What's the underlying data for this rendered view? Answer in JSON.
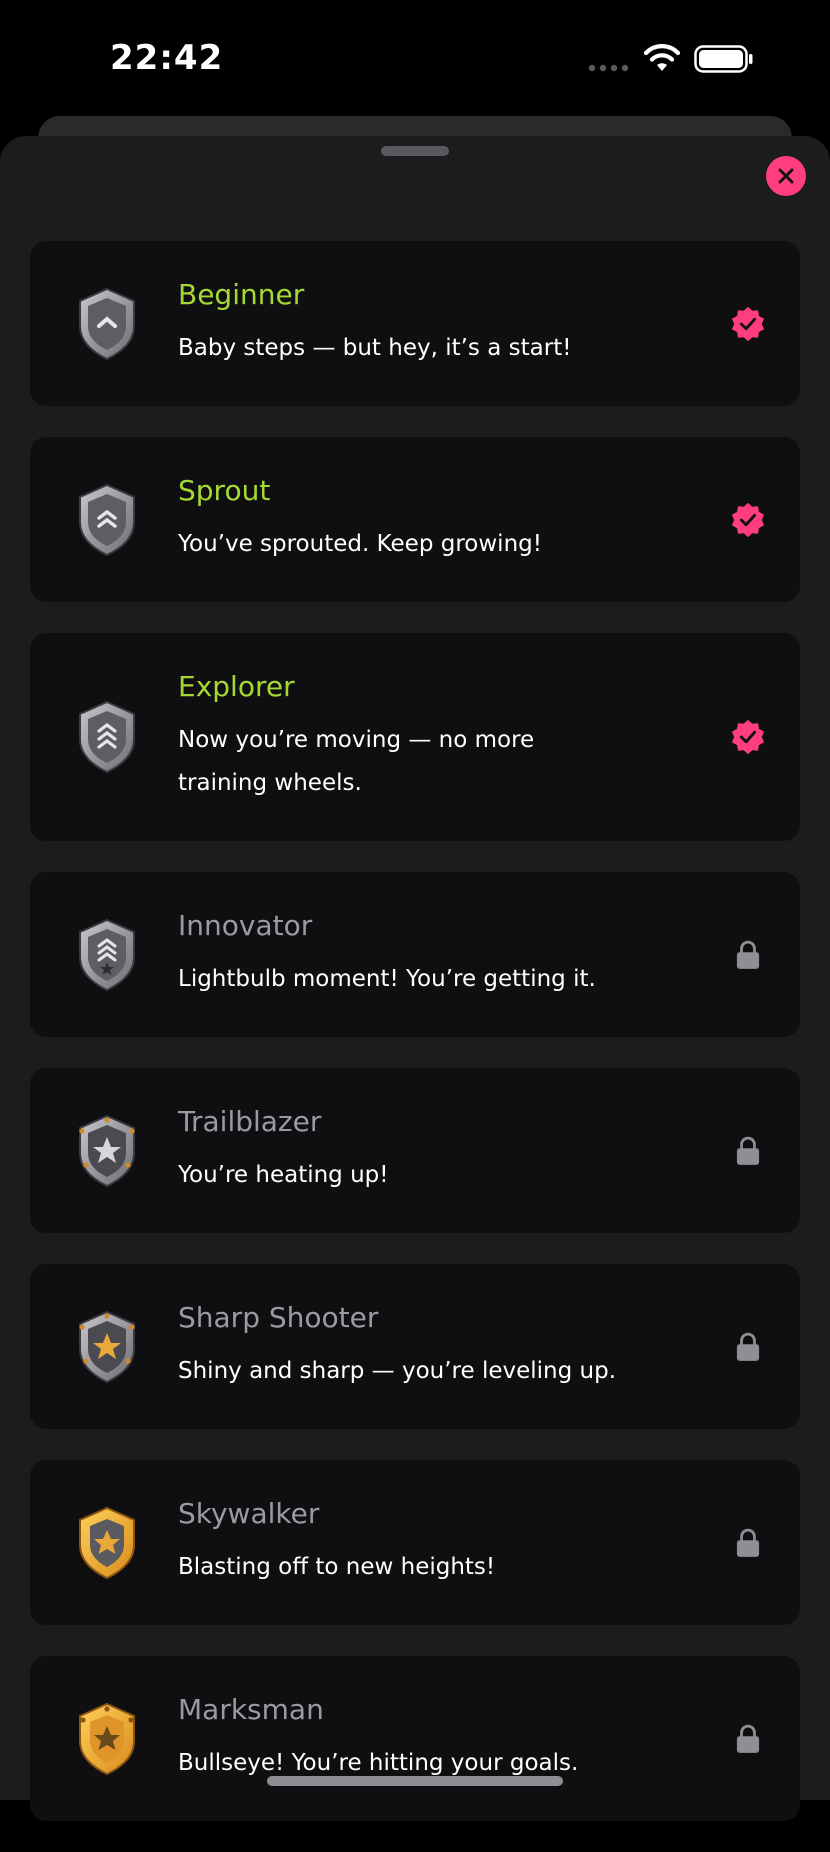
{
  "status_bar": {
    "time": "22:42"
  },
  "colors": {
    "accent": "#ff3d7f",
    "unlocked_title": "#a6d833",
    "locked_title": "#9a9aa0",
    "card_bg": "#0f0f11",
    "sheet_bg": "#1c1c1e"
  },
  "sheet": {
    "close_icon": "close-icon"
  },
  "badges": [
    {
      "title": "Beginner",
      "description": "Baby steps — but hey, it’s a start!",
      "status": "unlocked",
      "icon": "shield-chevron-1-icon"
    },
    {
      "title": "Sprout",
      "description": "You’ve sprouted. Keep growing!",
      "status": "unlocked",
      "icon": "shield-chevron-2-icon"
    },
    {
      "title": "Explorer",
      "description": "Now you’re moving — no more training wheels.",
      "status": "unlocked",
      "icon": "shield-chevron-3-icon"
    },
    {
      "title": "Innovator",
      "description": "Lightbulb moment! You’re getting it.",
      "status": "locked",
      "icon": "shield-chevron-star-icon"
    },
    {
      "title": "Trailblazer",
      "description": "You’re heating up!",
      "status": "locked",
      "icon": "shield-silver-star-icon"
    },
    {
      "title": "Sharp Shooter",
      "description": "Shiny and sharp — you’re leveling up.",
      "status": "locked",
      "icon": "shield-gold-star-icon"
    },
    {
      "title": "Skywalker",
      "description": "Blasting off to new heights!",
      "status": "locked",
      "icon": "gold-shield-star-icon"
    },
    {
      "title": "Marksman",
      "description": "Bullseye! You’re hitting your goals.",
      "status": "locked",
      "icon": "gold-shield-star-ornate-icon"
    }
  ]
}
